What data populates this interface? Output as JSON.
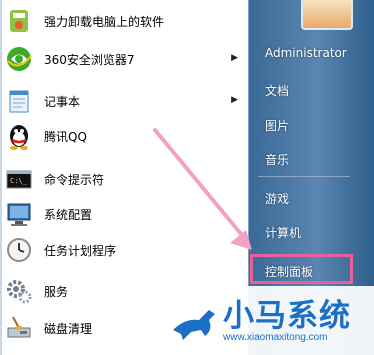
{
  "programs": [
    {
      "label": "强力卸载电脑上的软件",
      "icon": "uninstall-icon",
      "submenu": false
    },
    {
      "label": "360安全浏览器7",
      "icon": "browser-360-icon",
      "submenu": true
    },
    {
      "label": "记事本",
      "icon": "notepad-icon",
      "submenu": true
    },
    {
      "label": "腾讯QQ",
      "icon": "qq-penguin-icon",
      "submenu": false
    },
    {
      "label": "命令提示符",
      "icon": "cmd-icon",
      "submenu": false
    },
    {
      "label": "系统配置",
      "icon": "system-config-icon",
      "submenu": false
    },
    {
      "label": "任务计划程序",
      "icon": "task-scheduler-icon",
      "submenu": false
    },
    {
      "label": "服务",
      "icon": "services-gear-icon",
      "submenu": false
    },
    {
      "label": "磁盘清理",
      "icon": "disk-cleanup-icon",
      "submenu": false
    }
  ],
  "right_menu": {
    "user": "Administrator",
    "documents": "文档",
    "pictures": "图片",
    "music": "音乐",
    "games": "游戏",
    "computer": "计算机",
    "control_panel": "控制面板"
  },
  "watermark": {
    "title": "小马系统",
    "url": "www.xiaomaxitong.com"
  },
  "colors": {
    "highlight": "#e8609a",
    "pane_blue": "#3b6a96",
    "watermark_blue": "#1a6fc6"
  }
}
